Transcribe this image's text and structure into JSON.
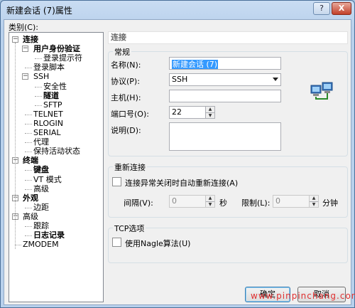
{
  "window": {
    "title": "新建会话 (7)属性",
    "help_label": "?",
    "close_label": "X"
  },
  "category": {
    "label": "类别(C):",
    "tree": [
      {
        "label": "连接",
        "bold": true,
        "toggle": "−"
      },
      {
        "label": "用户身份验证",
        "bold": true,
        "toggle": "−"
      },
      {
        "label": "登录提示符",
        "bold": false,
        "toggle": ""
      },
      {
        "label": "登录脚本",
        "bold": false,
        "toggle": ""
      },
      {
        "label": "SSH",
        "bold": false,
        "toggle": "−"
      },
      {
        "label": "安全性",
        "bold": false,
        "toggle": ""
      },
      {
        "label": "隧道",
        "bold": true,
        "toggle": ""
      },
      {
        "label": "SFTP",
        "bold": false,
        "toggle": ""
      },
      {
        "label": "TELNET",
        "bold": false,
        "toggle": ""
      },
      {
        "label": "RLOGIN",
        "bold": false,
        "toggle": ""
      },
      {
        "label": "SERIAL",
        "bold": false,
        "toggle": ""
      },
      {
        "label": "代理",
        "bold": false,
        "toggle": ""
      },
      {
        "label": "保持活动状态",
        "bold": false,
        "toggle": ""
      },
      {
        "label": "终端",
        "bold": true,
        "toggle": "−"
      },
      {
        "label": "键盘",
        "bold": true,
        "toggle": ""
      },
      {
        "label": "VT 模式",
        "bold": false,
        "toggle": ""
      },
      {
        "label": "高级",
        "bold": false,
        "toggle": ""
      },
      {
        "label": "外观",
        "bold": true,
        "toggle": "−"
      },
      {
        "label": "边距",
        "bold": false,
        "toggle": ""
      },
      {
        "label": "高级",
        "bold": false,
        "toggle": "−"
      },
      {
        "label": "跟踪",
        "bold": false,
        "toggle": ""
      },
      {
        "label": "日志记录",
        "bold": true,
        "toggle": ""
      },
      {
        "label": "ZMODEM",
        "bold": false,
        "toggle": ""
      }
    ]
  },
  "panel": {
    "title": "连接",
    "general": {
      "title": "常规",
      "name_label": "名称(N):",
      "name_value": "新建会话 (7)",
      "protocol_label": "协议(P):",
      "protocol_value": "SSH",
      "host_label": "主机(H):",
      "host_value": "",
      "port_label": "端口号(O):",
      "port_value": "22",
      "desc_label": "说明(D):",
      "desc_value": ""
    },
    "reconnect": {
      "title": "重新连接",
      "auto_label": "连接异常关闭时自动重新连接(A)",
      "interval_label": "间隔(V):",
      "interval_value": "0",
      "interval_unit": "秒",
      "limit_label": "限制(L):",
      "limit_value": "0",
      "limit_unit": "分钟"
    },
    "tcp": {
      "title": "TCP选项",
      "nagle_label": "使用Nagle算法(U)"
    }
  },
  "footer": {
    "ok_label": "确定",
    "cancel_label": "取消"
  },
  "watermark": "www.pinpinchang.com"
}
